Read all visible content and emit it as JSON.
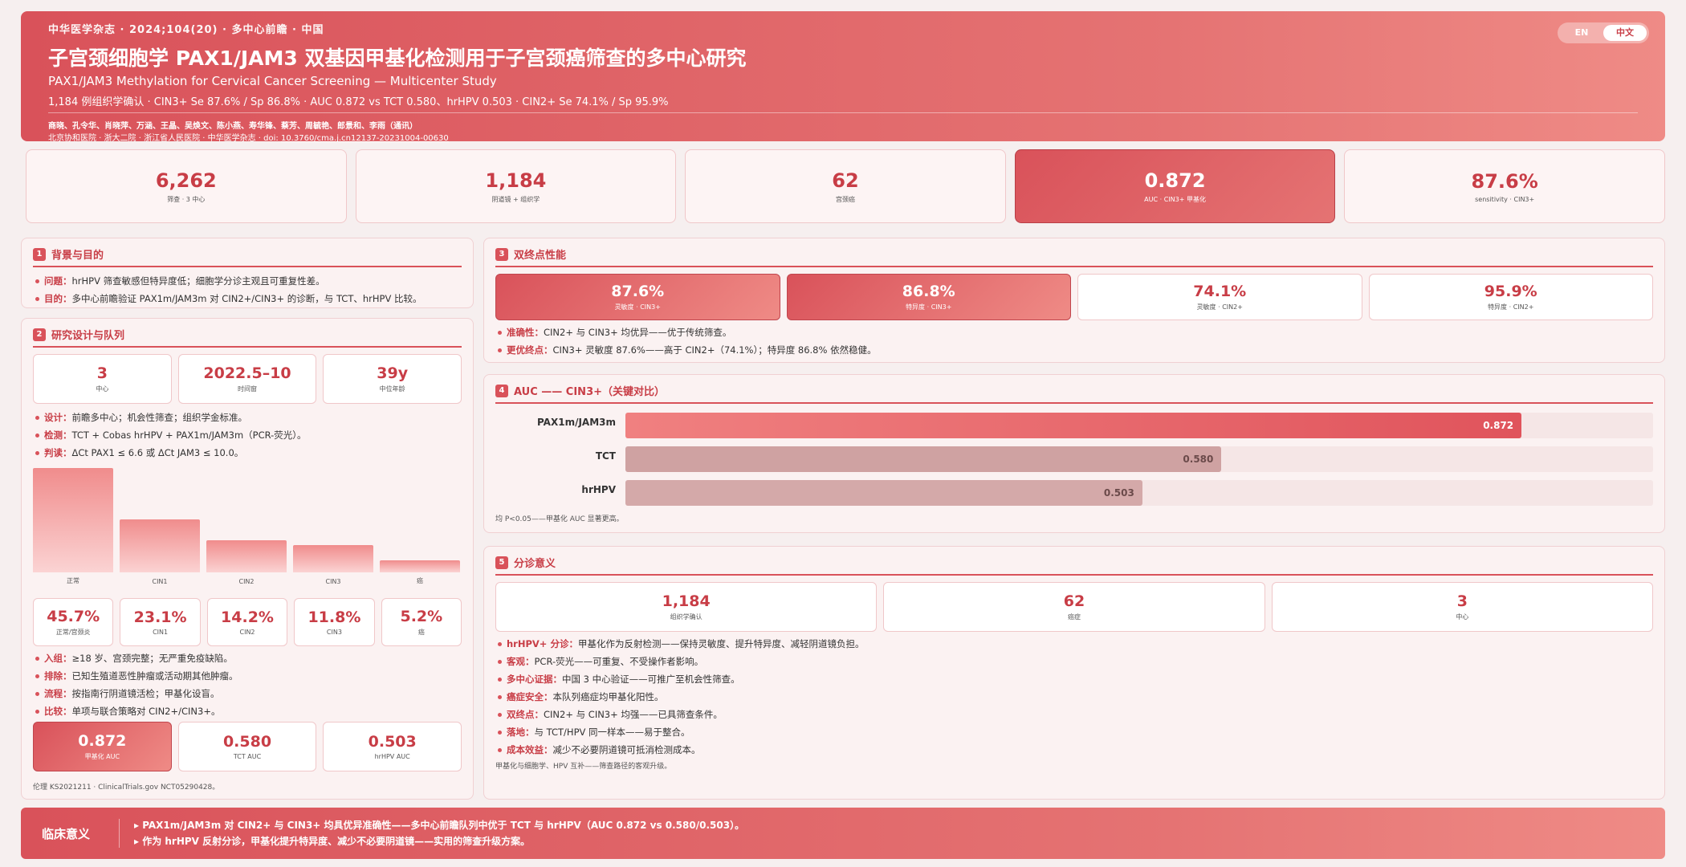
{
  "header": {
    "meta": "中华医学杂志 · 2024;104(20) · 多中心前瞻 · 中国",
    "title": "子宫颈细胞学 PAX1/JAM3 双基因甲基化检测用于子宫颈癌筛查的多中心研究",
    "subtitle": "PAX1/JAM3 Methylation for Cervical Cancer Screening — Multicenter Study",
    "stats": "1,184 例组织学确认 · CIN3+ Se 87.6% / Sp 86.8% · AUC 0.872 vs TCT 0.580、hrHPV 0.503 · CIN2+ Se 74.1% / Sp 95.9%",
    "authors": "商晓、孔令华、肖晓萍、万涵、王晶、吴焕文、陈小燕、寿华锋、蔡芳、周毓艳、郎景和、李雨（通讯）",
    "affiliations": "北京协和医院 · 浙大二院 · 浙江省人民医院 · 中华医学杂志 · doi:",
    "doi": "10.3760/cma.j.cn12137-20231004-00630"
  },
  "lang": {
    "en": "EN",
    "zh": "中文",
    "selected": "zh"
  },
  "kpis": [
    {
      "value": "6,262",
      "label": "筛查 · 3 中心"
    },
    {
      "value": "1,184",
      "label": "阴道镜 + 组织学"
    },
    {
      "value": "62",
      "label": "宫颈癌"
    },
    {
      "value": "0.872",
      "label": "AUC · CIN3+ 甲基化"
    },
    {
      "value": "87.6%",
      "label": "sensitivity · CIN3+"
    }
  ],
  "s1": {
    "num": "1",
    "title": "背景与目的",
    "items": [
      {
        "k": "问题：",
        "t": "hrHPV 筛查敏感但特异度低；细胞学分诊主观且可重复性差。"
      },
      {
        "k": "目的：",
        "t": "多中心前瞻验证 PAX1m/JAM3m 对 CIN2+/CIN3+ 的诊断，与 TCT、hrHPV 比较。"
      }
    ]
  },
  "s2": {
    "num": "2",
    "title": "研究设计与队列",
    "cards": [
      {
        "value": "3",
        "label": "中心"
      },
      {
        "value": "2022.5–10",
        "label": "时间窗"
      },
      {
        "value": "39y",
        "label": "中位年龄"
      }
    ],
    "items_a": [
      {
        "k": "设计：",
        "t": "前瞻多中心；机会性筛查；组织学金标准。"
      },
      {
        "k": "检测：",
        "t": "TCT + Cobas hrHPV + PAX1m/JAM3m（PCR-荧光）。"
      },
      {
        "k": "判读：",
        "t": "ΔCt PAX1 ≤ 6.6 或 ΔCt JAM3 ≤ 10.0。"
      }
    ],
    "dist": [
      {
        "value": "45.7%",
        "label": "正常/宫颈炎",
        "bar_label": "正常",
        "pct": 45.7
      },
      {
        "value": "23.1%",
        "label": "CIN1",
        "bar_label": "CIN1",
        "pct": 23.1
      },
      {
        "value": "14.2%",
        "label": "CIN2",
        "bar_label": "CIN2",
        "pct": 14.2
      },
      {
        "value": "11.8%",
        "label": "CIN3",
        "bar_label": "CIN3",
        "pct": 11.8
      },
      {
        "value": "5.2%",
        "label": "癌",
        "bar_label": "癌",
        "pct": 5.2
      }
    ],
    "items_b": [
      {
        "k": "入组：",
        "t": "≥18 岁、宫颈完整；无严重免疫缺陷。"
      },
      {
        "k": "排除：",
        "t": "已知生殖道恶性肿瘤或活动期其他肿瘤。"
      },
      {
        "k": "流程：",
        "t": "按指南行阴道镜活检；甲基化设盲。"
      },
      {
        "k": "比较：",
        "t": "单项与联合策略对 CIN2+/CIN3+。"
      }
    ],
    "auc_cards": [
      {
        "value": "0.872",
        "label": "甲基化 AUC"
      },
      {
        "value": "0.580",
        "label": "TCT AUC"
      },
      {
        "value": "0.503",
        "label": "hrHPV AUC"
      }
    ],
    "ethics": "伦理 KS2021211 · ClinicalTrials.gov NCT05290428。"
  },
  "s3": {
    "num": "3",
    "title": "双终点性能",
    "cards": [
      {
        "value": "87.6%",
        "label": "灵敏度 · CIN3+"
      },
      {
        "value": "86.8%",
        "label": "特异度 · CIN3+"
      },
      {
        "value": "74.1%",
        "label": "灵敏度 · CIN2+"
      },
      {
        "value": "95.9%",
        "label": "特异度 · CIN2+"
      }
    ],
    "items": [
      {
        "k": "准确性：",
        "t": "CIN2+ 与 CIN3+ 均优异——优于传统筛查。"
      },
      {
        "k": "更优终点：",
        "t": "CIN3+ 灵敏度 87.6%——高于 CIN2+（74.1%）；特异度 86.8% 依然稳健。"
      }
    ]
  },
  "s4": {
    "num": "4",
    "title": "AUC —— CIN3+（关键对比）",
    "note": "均 P<0.05——甲基化 AUC 显著更高。"
  },
  "chart_data": {
    "type": "bar",
    "orientation": "horizontal",
    "categories": [
      "PAX1m/JAM3m",
      "TCT",
      "hrHPV"
    ],
    "values": [
      0.872,
      0.58,
      0.503
    ],
    "labels": [
      "0.872",
      "0.580",
      "0.503"
    ],
    "xlim": [
      0,
      1
    ],
    "colors": [
      "#e0545c",
      "#cfa2a2",
      "#d4a9a9"
    ]
  },
  "s5": {
    "num": "5",
    "title": "分诊意义",
    "cards": [
      {
        "value": "1,184",
        "label": "组织学确认"
      },
      {
        "value": "62",
        "label": "癌症"
      },
      {
        "value": "3",
        "label": "中心"
      }
    ],
    "items": [
      {
        "k": "hrHPV+ 分诊：",
        "t": "甲基化作为反射检测——保持灵敏度、提升特异度、减轻阴道镜负担。"
      },
      {
        "k": "客观：",
        "t": "PCR-荧光——可重复、不受操作者影响。"
      },
      {
        "k": "多中心证据：",
        "t": "中国 3 中心验证——可推广至机会性筛查。"
      },
      {
        "k": "癌症安全：",
        "t": "本队列癌症均甲基化阳性。"
      },
      {
        "k": "双终点：",
        "t": "CIN2+ 与 CIN3+ 均强——已具筛查条件。"
      },
      {
        "k": "落地：",
        "t": "与 TCT/HPV 同一样本——易于整合。"
      },
      {
        "k": "成本效益：",
        "t": "减少不必要阴道镜可抵消检测成本。"
      }
    ],
    "note": "甲基化与细胞学、HPV 互补——筛查路径的客观升级。"
  },
  "footer": {
    "title": "临床意义",
    "lines": [
      "▸ PAX1m/JAM3m 对 CIN2+ 与 CIN3+ 均具优异准确性——多中心前瞻队列中优于 TCT 与 hrHPV（AUC 0.872 vs 0.580/0.503）。",
      "▸ 作为 hrHPV 反射分诊，甲基化提升特异度、减少不必要阴道镜——实用的筛查升级方案。"
    ]
  },
  "colors": {
    "accent": "#d9525a",
    "accent_dark": "#c83d46",
    "light": "#fbf2f2"
  }
}
